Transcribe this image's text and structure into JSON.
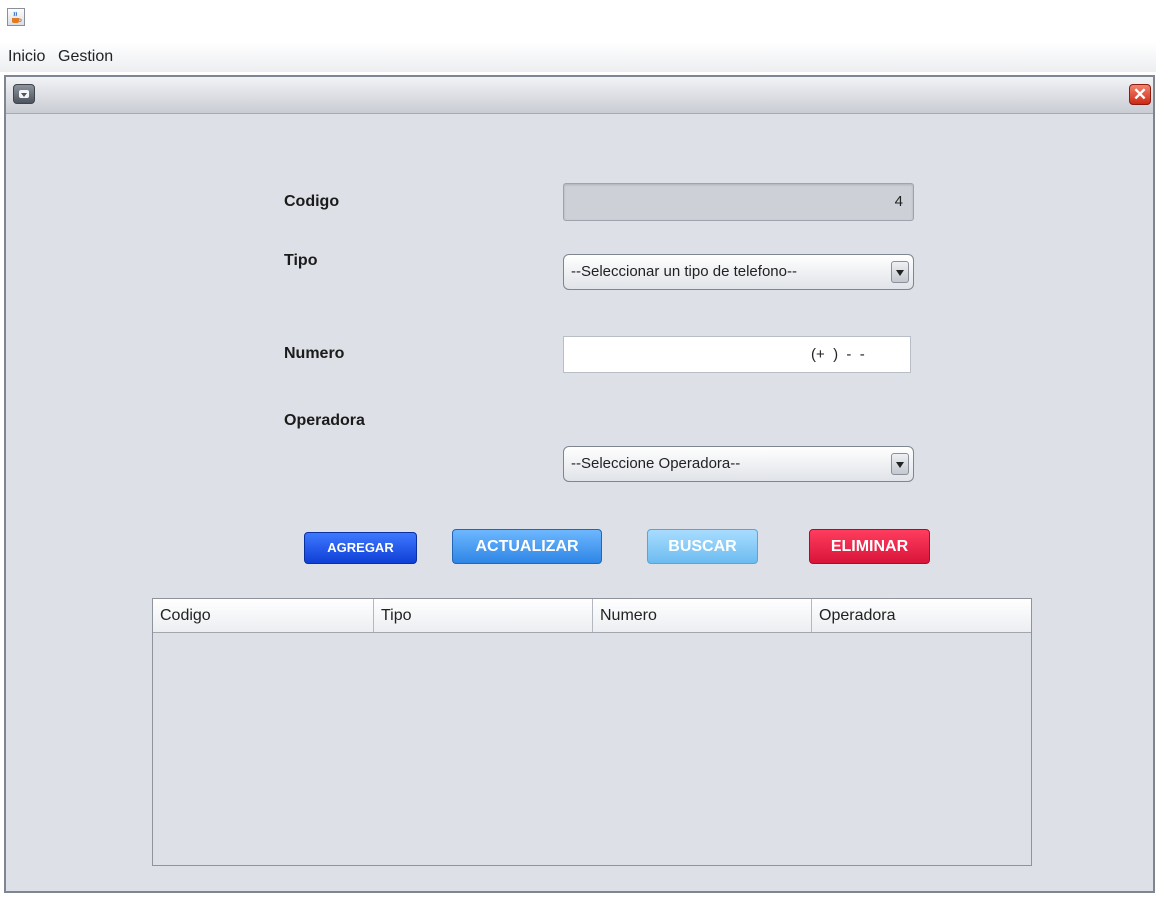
{
  "menubar": {
    "items": [
      {
        "label": "Inicio"
      },
      {
        "label": "Gestion"
      }
    ]
  },
  "form": {
    "codigo_label": "Codigo",
    "codigo_value": "4",
    "tipo_label": "Tipo",
    "tipo_selected": "--Seleccionar un tipo de telefono--",
    "numero_label": "Numero",
    "numero_mask": "(+  )  -  -",
    "operadora_label": "Operadora",
    "operadora_selected": "--Seleccione Operadora--"
  },
  "buttons": {
    "agregar": "AGREGAR",
    "actualizar": "ACTUALIZAR",
    "buscar": "BUSCAR",
    "eliminar": "ELIMINAR"
  },
  "table": {
    "columns": [
      "Codigo",
      "Tipo",
      "Numero",
      "Operadora"
    ],
    "rows": []
  },
  "colors": {
    "agregar": "#1f54f0",
    "actualizar": "#4a9ff0",
    "buscar": "#8fcdf7",
    "eliminar": "#f02a4c",
    "close": "#e0432b"
  },
  "icons": {
    "app": "java-cup-icon",
    "frame_menu": "frame-menu-icon",
    "close": "close-icon"
  }
}
